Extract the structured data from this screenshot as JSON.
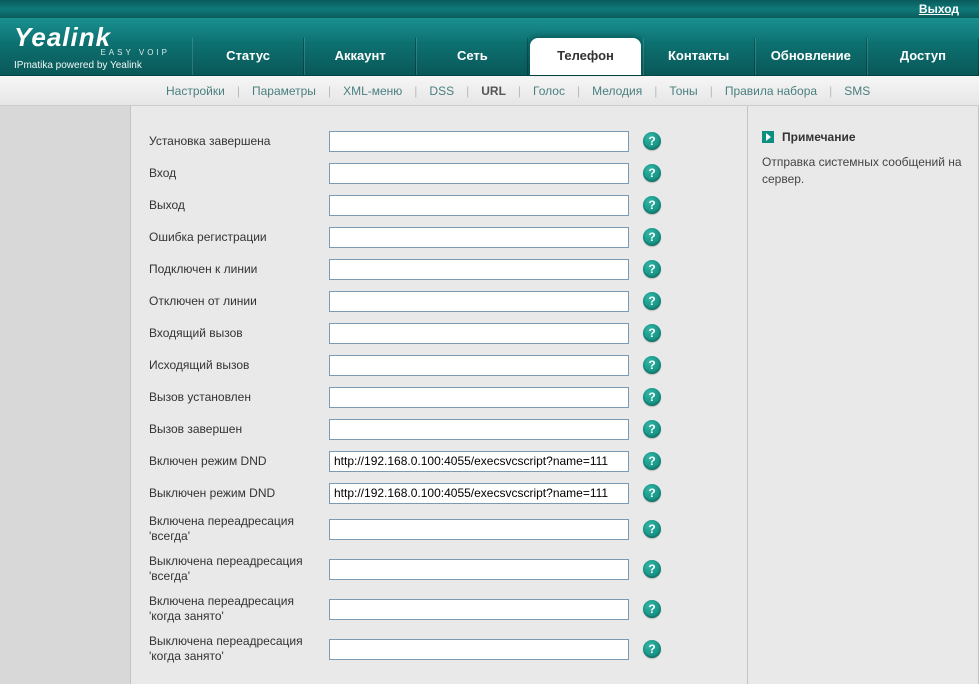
{
  "topbar": {
    "logout": "Выход"
  },
  "logo": {
    "main": "Yealink",
    "easy": "EASY VOIP",
    "sub": "IPmatika powered by Yealink"
  },
  "mainTabs": [
    {
      "label": "Статус",
      "active": false
    },
    {
      "label": "Аккаунт",
      "active": false
    },
    {
      "label": "Сеть",
      "active": false
    },
    {
      "label": "Телефон",
      "active": true
    },
    {
      "label": "Контакты",
      "active": false
    },
    {
      "label": "Обновление",
      "active": false
    },
    {
      "label": "Доступ",
      "active": false
    }
  ],
  "subnav": [
    {
      "label": "Настройки",
      "active": false
    },
    {
      "label": "Параметры",
      "active": false
    },
    {
      "label": "XML-меню",
      "active": false
    },
    {
      "label": "DSS",
      "active": false
    },
    {
      "label": "URL",
      "active": true
    },
    {
      "label": "Голос",
      "active": false
    },
    {
      "label": "Мелодия",
      "active": false
    },
    {
      "label": "Тоны",
      "active": false
    },
    {
      "label": "Правила набора",
      "active": false
    },
    {
      "label": "SMS",
      "active": false
    }
  ],
  "fields": [
    {
      "label": "Установка завершена",
      "value": ""
    },
    {
      "label": "Вход",
      "value": ""
    },
    {
      "label": "Выход",
      "value": ""
    },
    {
      "label": "Ошибка регистрации",
      "value": ""
    },
    {
      "label": "Подключен к линии",
      "value": ""
    },
    {
      "label": "Отключен от линии",
      "value": ""
    },
    {
      "label": "Входящий вызов",
      "value": ""
    },
    {
      "label": "Исходящий вызов",
      "value": ""
    },
    {
      "label": "Вызов установлен",
      "value": ""
    },
    {
      "label": "Вызов завершен",
      "value": ""
    },
    {
      "label": "Включен режим DND",
      "value": "http://192.168.0.100:4055/execsvcscript?name=111"
    },
    {
      "label": "Выключен режим DND",
      "value": "http://192.168.0.100:4055/execsvcscript?name=111"
    },
    {
      "label": "Включена переадресация 'всегда'",
      "value": ""
    },
    {
      "label": "Выключена переадресация 'всегда'",
      "value": ""
    },
    {
      "label": "Включена переадресация 'когда занято'",
      "value": ""
    },
    {
      "label": "Выключена переадресация 'когда занято'",
      "value": ""
    }
  ],
  "note": {
    "title": "Примечание",
    "text": "Отправка системных сообщений на сервер."
  },
  "helpGlyph": "?"
}
